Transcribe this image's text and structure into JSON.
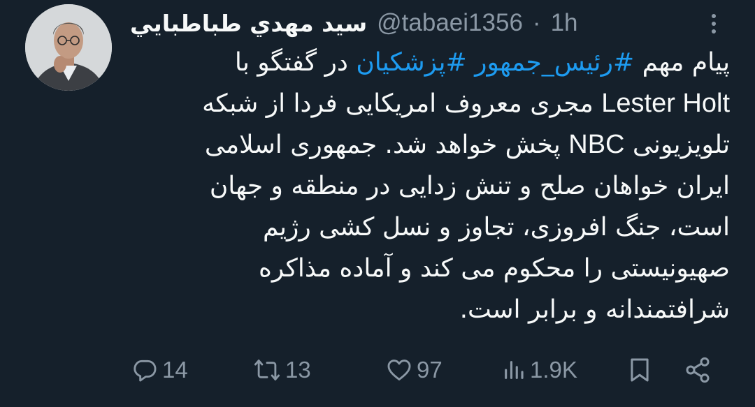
{
  "author": {
    "display_name": "سيد مهدي طباطبايي",
    "handle": "@tabaei1356",
    "separator": "·",
    "time": "1h"
  },
  "tweet": {
    "line1": {
      "pre": "پیام مهم ",
      "hashtag1": "#رئیس_جمهور",
      "space": " ",
      "hashtag2": "#پزشکیان",
      "post": " در گفتگو با"
    },
    "line2": {
      "latin": "Lester Holt",
      "rest": " مجری معروف امریکایی فردا از شبکه"
    },
    "line3": {
      "pre": "تلویزیونی ",
      "latin": "NBC",
      "rest": " پخش خواهد شد. جمهوری اسلامی"
    },
    "line4": "ایران خواهان صلح و تنش زدایی در منطقه و جهان",
    "line5": "است، جنگ افروزی، تجاوز و نسل کشی رژیم",
    "line6": "صهیونیستی را محکوم می کند و آماده مذاکره",
    "line7": "شرافتمندانه و برابر است."
  },
  "actions": {
    "replies": "14",
    "retweets": "13",
    "likes": "97",
    "views": "1.9K"
  },
  "icons": {
    "reply": "reply-icon",
    "retweet": "retweet-icon",
    "like": "heart-icon",
    "views": "views-icon",
    "bookmark": "bookmark-icon",
    "share": "share-icon",
    "more": "more-icon"
  },
  "colors": {
    "background": "#15202b",
    "text": "#f7f9f9",
    "muted": "#8b98a5",
    "accent": "#1d9bf0"
  }
}
